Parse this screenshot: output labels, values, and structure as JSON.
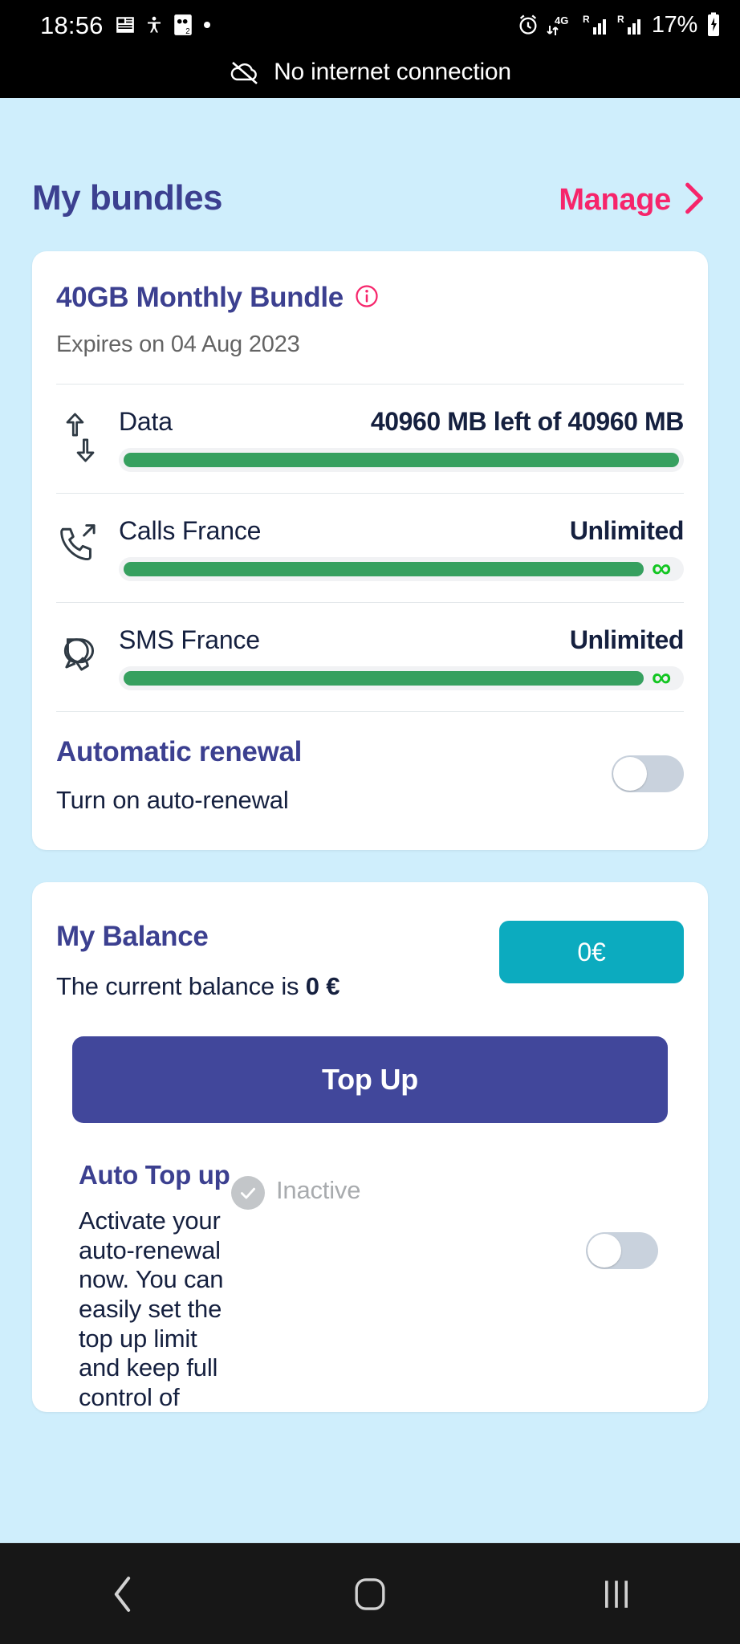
{
  "status_bar": {
    "clock": "18:56",
    "left_icons": [
      "news-icon",
      "accessibility-icon",
      "dual-sim-icon",
      "dot-icon"
    ],
    "right_icons": [
      "alarm-icon",
      "4g-data-icon",
      "signal-roaming-1-icon",
      "signal-roaming-2-icon",
      "battery-charging-icon"
    ],
    "battery_percent": "17%",
    "network_label": "4G",
    "notice": "No internet connection",
    "notice_icon": "cloud-off-icon"
  },
  "header": {
    "title": "My bundles",
    "manage_label": "Manage",
    "manage_icon": "chevron-right-icon"
  },
  "bundle_card": {
    "title": "40GB Monthly Bundle",
    "info_icon": "info-icon",
    "expiry": "Expires on 04 Aug 2023",
    "allocations": [
      {
        "icon": "data-arrows-icon",
        "label": "Data",
        "value": "40960 MB left of 40960 MB",
        "percent": 100,
        "unlimited": false
      },
      {
        "icon": "phone-outgoing-icon",
        "label": "Calls France",
        "value": "Unlimited",
        "percent": 100,
        "unlimited": true,
        "infinity_symbol": "∞"
      },
      {
        "icon": "sms-bubble-icon",
        "label": "SMS France",
        "value": "Unlimited",
        "percent": 100,
        "unlimited": true,
        "infinity_symbol": "∞"
      }
    ],
    "renewal": {
      "title": "Automatic renewal",
      "subtitle": "Turn on auto-renewal",
      "toggle_state": "off"
    }
  },
  "balance_card": {
    "title": "My Balance",
    "badge_value": "0€",
    "subtitle_prefix": "The current balance is ",
    "subtitle_amount": "0 €",
    "topup_label": "Top Up",
    "auto_topup": {
      "title": "Auto Top up",
      "status_icon": "check-circle-icon",
      "status_label": "Inactive",
      "description": "Activate your auto-renewal now. You can easily set the top up limit and keep full control of",
      "toggle_state": "off"
    }
  },
  "nav_bar": {
    "back_icon": "back-chevron-icon",
    "home_icon": "home-square-icon",
    "recents_icon": "recents-bars-icon"
  },
  "colors": {
    "page_background": "#cfeefc",
    "indigo": "#3c4090",
    "pink": "#f6256b",
    "navy_text": "#15203f",
    "green_bar": "#36a05f",
    "green_infinity": "#13c622",
    "teal_badge": "#0cabbf",
    "topup_button": "#41479b",
    "toggle_off_track": "#c9d2dd"
  }
}
